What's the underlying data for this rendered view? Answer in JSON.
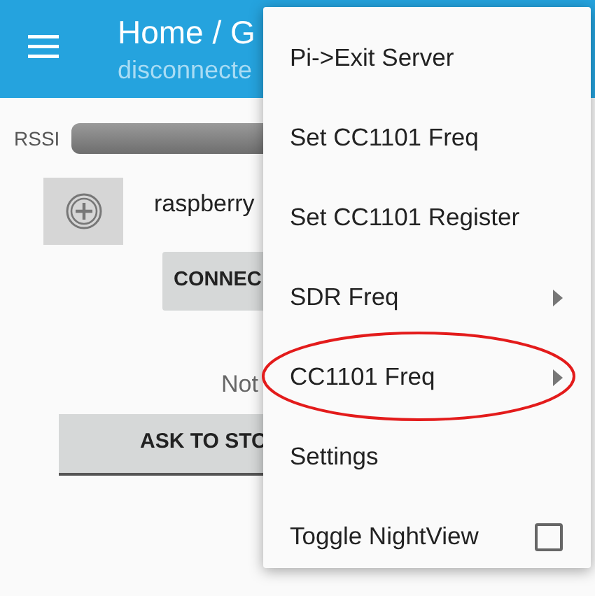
{
  "app_bar": {
    "title": "Home / G",
    "subtitle": "disconnecte"
  },
  "rssi": {
    "label": "RSSI"
  },
  "device": {
    "name": "raspberry",
    "button": "CONNEC"
  },
  "status": "Not",
  "action_button": "ASK TO STO",
  "menu": {
    "items": [
      {
        "label": "Pi->Exit Server",
        "kind": "plain",
        "circled": false
      },
      {
        "label": "Set CC1101 Freq",
        "kind": "plain",
        "circled": false
      },
      {
        "label": "Set CC1101 Register",
        "kind": "plain",
        "circled": false
      },
      {
        "label": "SDR Freq",
        "kind": "submenu",
        "circled": false
      },
      {
        "label": "CC1101 Freq",
        "kind": "submenu",
        "circled": true
      },
      {
        "label": "Settings",
        "kind": "plain",
        "circled": false
      },
      {
        "label": "Toggle NightView",
        "kind": "checkbox",
        "checked": false,
        "circled": false
      }
    ]
  }
}
